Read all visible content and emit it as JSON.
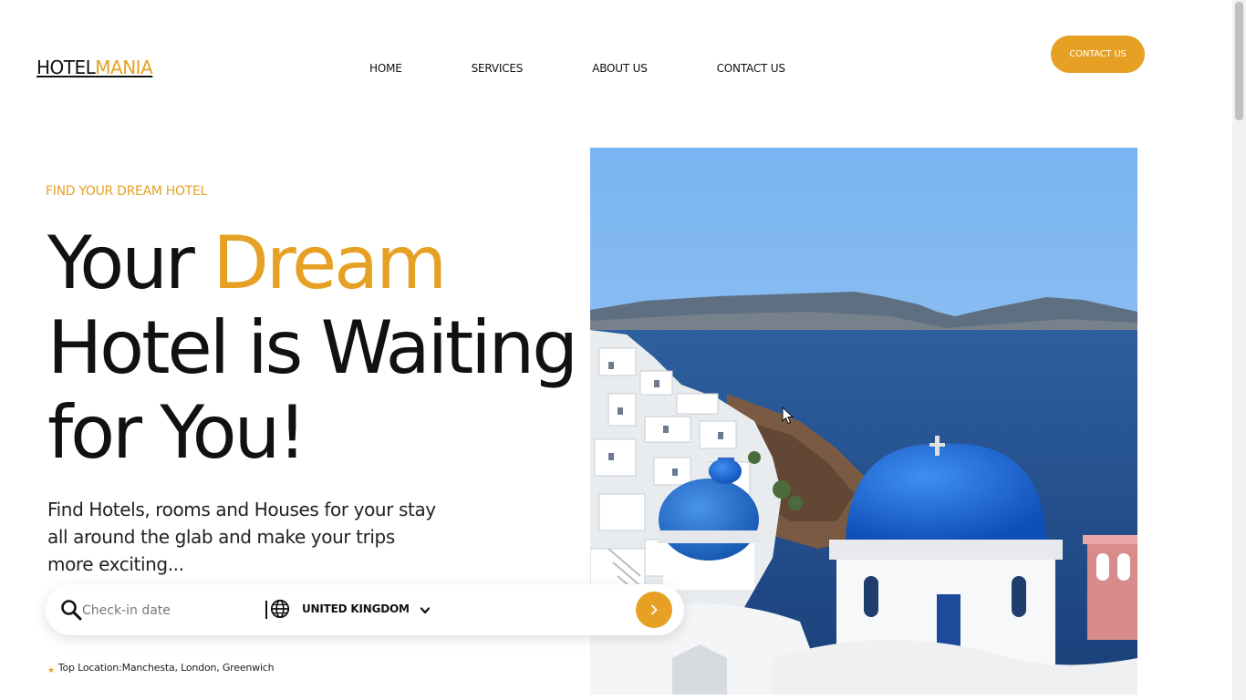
{
  "header": {
    "logo_part1": "HOTEL",
    "logo_part2": "MANIA",
    "nav": [
      "HOME",
      "SERVICES",
      "ABOUT US",
      "CONTACT US"
    ],
    "contact_button": "CONTACT US"
  },
  "hero": {
    "eyebrow": "FIND YOUR DREAM HOTEL",
    "headline_part1": "Your ",
    "headline_accent": "Dream",
    "headline_part2": "Hotel is Waiting for You!",
    "subtext": "Find Hotels, rooms and Houses for your stay all around the glab and make your trips more exciting...",
    "image_alt": "Santorini blue domes overlooking the sea"
  },
  "search": {
    "checkin_placeholder": "Check-in date",
    "country": "UNITED KINGDOM"
  },
  "top_location": {
    "text": "Top Location:Manchesta, London, Greenwich"
  },
  "colors": {
    "accent": "#e6a124",
    "text": "#111111"
  },
  "icons": [
    "search-icon",
    "globe-icon",
    "chevron-down-icon",
    "arrow-right-icon",
    "star-icon"
  ]
}
